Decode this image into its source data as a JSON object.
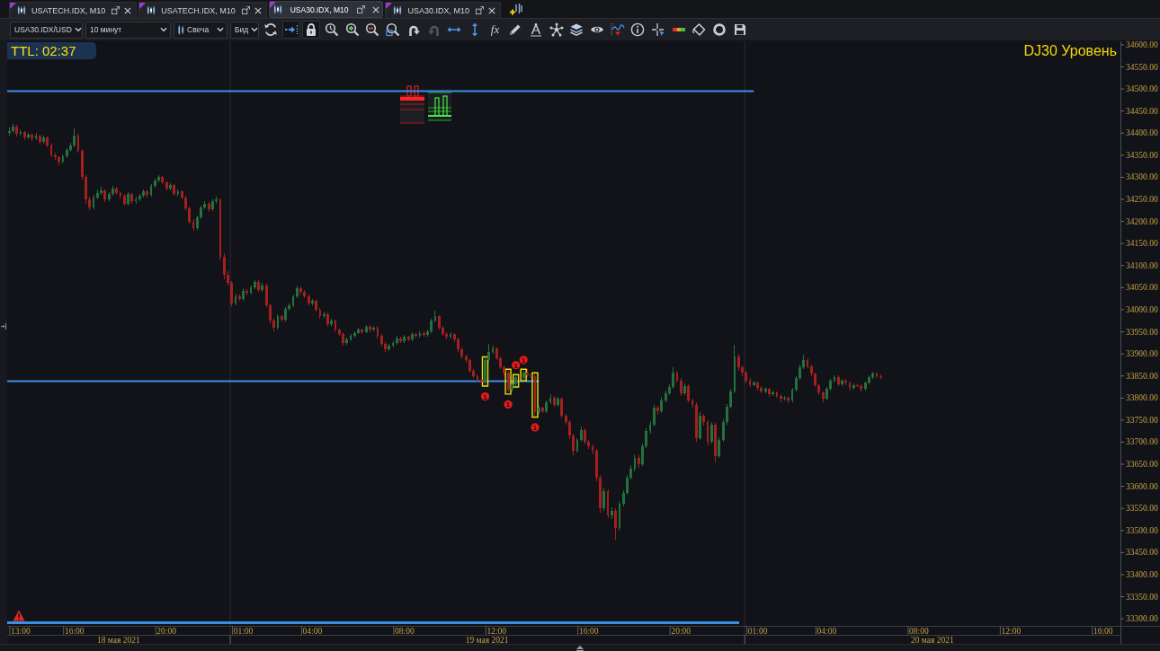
{
  "tabs": [
    {
      "label": "USATECH.IDX, M10",
      "selected": false
    },
    {
      "label": "USATECH.IDX, M10",
      "selected": false
    },
    {
      "label": "USA30.IDX, M10",
      "selected": true
    },
    {
      "label": "USA30.IDX, M10",
      "selected": false
    }
  ],
  "toolbar": {
    "symbol": "USA30.IDX/USD",
    "timeframe": "10 минут",
    "chart_type": "Свеча",
    "price_type": "Бид",
    "tools": [
      {
        "kind": "refresh",
        "on": false,
        "disabled": false
      },
      {
        "kind": "autoscroll",
        "on": true,
        "disabled": false
      },
      {
        "kind": "lock",
        "on": true,
        "disabled": false
      },
      {
        "kind": "zoom_reset",
        "on": false,
        "disabled": false
      },
      {
        "kind": "zoom_in",
        "on": false,
        "disabled": false
      },
      {
        "kind": "zoom_out",
        "on": false,
        "disabled": false
      },
      {
        "kind": "zoom_area",
        "on": false,
        "disabled": false
      },
      {
        "kind": "undo",
        "on": false,
        "disabled": false
      },
      {
        "kind": "redo",
        "on": false,
        "disabled": true
      },
      {
        "kind": "fit_horizontal",
        "on": false,
        "disabled": false
      },
      {
        "kind": "fit_vertical",
        "on": false,
        "disabled": false
      },
      {
        "kind": "indicator",
        "label": "fx",
        "on": false,
        "disabled": false
      },
      {
        "kind": "draw",
        "on": false,
        "disabled": false
      },
      {
        "kind": "text",
        "on": false,
        "disabled": false
      },
      {
        "kind": "objects",
        "on": false,
        "disabled": false
      },
      {
        "kind": "layers",
        "on": false,
        "disabled": false
      },
      {
        "kind": "visibility",
        "on": false,
        "disabled": false
      },
      {
        "kind": "overlay",
        "on": false,
        "disabled": false
      },
      {
        "kind": "info",
        "on": false,
        "disabled": false
      },
      {
        "kind": "crosshair",
        "on": false,
        "disabled": false
      },
      {
        "kind": "volume",
        "on": false,
        "disabled": false
      },
      {
        "kind": "fill",
        "on": false,
        "disabled": false
      },
      {
        "kind": "ring",
        "on": false,
        "disabled": false
      },
      {
        "kind": "save",
        "on": false,
        "disabled": false
      }
    ]
  },
  "chart": {
    "ttl": "TTL: 02:37",
    "level_label": "DJ30 Уровень",
    "date_labels": [
      "18 мая 2021",
      "19 мая 2021",
      "20 мая 2021"
    ],
    "chart_data": {
      "type": "candlestick",
      "ylim": [
        33284,
        34610
      ],
      "categories": [
        null,
        null,
        null,
        "13:00",
        null,
        null,
        null,
        null,
        null,
        null,
        null,
        null,
        null,
        null,
        null,
        null,
        null,
        "16:00",
        null,
        null,
        null,
        null,
        null,
        null,
        null,
        null,
        null,
        null,
        null,
        null,
        null,
        null,
        null,
        null,
        null,
        null,
        null,
        null,
        null,
        null,
        null,
        "20:00",
        null,
        null,
        null,
        null,
        null,
        null,
        null,
        null,
        null,
        null,
        null,
        null,
        null,
        null,
        null,
        null,
        null,
        null,
        null,
        "01:00",
        null,
        null,
        null,
        null,
        null,
        null,
        null,
        null,
        null,
        null,
        null,
        null,
        null,
        null,
        null,
        null,
        null,
        "04:00",
        null,
        null,
        null,
        null,
        null,
        null,
        null,
        null,
        null,
        null,
        null,
        null,
        null,
        null,
        null,
        null,
        null,
        null,
        null,
        null,
        null,
        null,
        null,
        "08:00",
        null,
        null,
        null,
        null,
        null,
        null,
        null,
        null,
        null,
        null,
        null,
        null,
        null,
        null,
        null,
        null,
        null,
        null,
        null,
        null,
        null,
        null,
        null,
        "12:00",
        null,
        null,
        null,
        null,
        null,
        null,
        null,
        null,
        null,
        null,
        null,
        null,
        null,
        null,
        null,
        null,
        null,
        null,
        null,
        null,
        null,
        null,
        null,
        "16:00",
        null,
        null,
        null,
        null,
        null,
        null,
        null,
        null,
        null,
        null,
        null,
        null,
        null,
        null,
        null,
        null,
        null,
        null,
        null,
        null,
        null,
        null,
        null,
        "20:00",
        null,
        null,
        null,
        null,
        null,
        null,
        null,
        null,
        null,
        null,
        null,
        null,
        null,
        null,
        null,
        null,
        null,
        null,
        null,
        "01:00",
        null,
        null,
        null,
        null,
        null,
        null,
        null,
        null,
        null,
        null,
        null,
        null,
        null,
        null,
        null,
        null,
        null,
        "04:00",
        null,
        null,
        null,
        null,
        null,
        null,
        null,
        null,
        null,
        null,
        null,
        null,
        null,
        null,
        null,
        null,
        null,
        null,
        null,
        null,
        null,
        null,
        null,
        "08:00",
        null,
        null,
        null,
        null,
        null,
        null,
        null,
        null,
        null,
        null,
        null,
        null,
        null,
        null,
        null,
        null,
        null,
        null,
        null,
        null,
        null,
        null,
        null,
        "12:00",
        null,
        null,
        null,
        null,
        null,
        null,
        null,
        null,
        null,
        null,
        null,
        null,
        null,
        null,
        null,
        null,
        null,
        null,
        null,
        null,
        null,
        null,
        null,
        "16:00",
        null,
        null,
        null,
        null
      ],
      "yticks": [
        {
          "value": 34600,
          "label": "34600.00"
        },
        {
          "value": 34550,
          "label": "34550.00"
        },
        {
          "value": 34500,
          "label": "34500.00"
        },
        {
          "value": 34450,
          "label": "34450.00"
        },
        {
          "value": 34400,
          "label": "34400.00"
        },
        {
          "value": 34350,
          "label": "34350.00"
        },
        {
          "value": 34300,
          "label": "34300.00"
        },
        {
          "value": 34250,
          "label": "34250.00"
        },
        {
          "value": 34200,
          "label": "34200.00"
        },
        {
          "value": 34150,
          "label": "34150.00"
        },
        {
          "value": 34100,
          "label": "34100.00"
        },
        {
          "value": 34050,
          "label": "34050.00"
        },
        {
          "value": 34000,
          "label": "34000.00"
        },
        {
          "value": 33950,
          "label": "33950.00"
        },
        {
          "value": 33900,
          "label": "33900.00"
        },
        {
          "value": 33850,
          "label": "33850.00"
        },
        {
          "value": 33800,
          "label": "33800.00"
        },
        {
          "value": 33750,
          "label": "33750.00"
        },
        {
          "value": 33700,
          "label": "33700.00"
        },
        {
          "value": 33650,
          "label": "33650.00"
        },
        {
          "value": 33600,
          "label": "33600.00"
        },
        {
          "value": 33550,
          "label": "33550.00"
        },
        {
          "value": 33500,
          "label": "33500.00"
        },
        {
          "value": 33450,
          "label": "33450.00"
        },
        {
          "value": 33400,
          "label": "33400.00"
        },
        {
          "value": 33350,
          "label": "33350.00"
        },
        {
          "value": 33300,
          "label": "33300.00"
        }
      ],
      "ref_lines": [
        {
          "axis": "y",
          "value": 34495,
          "color": "#3a8ee6"
        },
        {
          "axis": "y",
          "value": 33838,
          "color": "#3a8ee6"
        }
      ],
      "annotations": [
        "1",
        "1",
        "1",
        "1",
        "1"
      ],
      "ohlc": [
        [
          34400,
          34412,
          34395,
          34405
        ],
        [
          34405,
          34420,
          34401,
          34415
        ],
        [
          34415,
          34418,
          34392,
          34398
        ],
        [
          34398,
          34408,
          34394,
          34402
        ],
        [
          34402,
          34405,
          34385,
          34390
        ],
        [
          34390,
          34400,
          34386,
          34396
        ],
        [
          34396,
          34399,
          34382,
          34388
        ],
        [
          34388,
          34400,
          34384,
          34395
        ],
        [
          34395,
          34397,
          34375,
          34380
        ],
        [
          34380,
          34394,
          34377,
          34390
        ],
        [
          34390,
          34392,
          34368,
          34372
        ],
        [
          34372,
          34376,
          34345,
          34350
        ],
        [
          34350,
          34356,
          34340,
          34345
        ],
        [
          34345,
          34348,
          34328,
          34335
        ],
        [
          34335,
          34352,
          34331,
          34348
        ],
        [
          34348,
          34366,
          34344,
          34362
        ],
        [
          34362,
          34378,
          34358,
          34372
        ],
        [
          34372,
          34410,
          34368,
          34395
        ],
        [
          34395,
          34398,
          34355,
          34360
        ],
        [
          34360,
          34364,
          34295,
          34300
        ],
        [
          34300,
          34305,
          34240,
          34250
        ],
        [
          34250,
          34256,
          34225,
          34232
        ],
        [
          34232,
          34260,
          34228,
          34255
        ],
        [
          34255,
          34272,
          34250,
          34265
        ],
        [
          34265,
          34278,
          34260,
          34270
        ],
        [
          34270,
          34273,
          34244,
          34250
        ],
        [
          34250,
          34266,
          34246,
          34262
        ],
        [
          34262,
          34280,
          34258,
          34275
        ],
        [
          34275,
          34279,
          34260,
          34265
        ],
        [
          34265,
          34268,
          34252,
          34258
        ],
        [
          34258,
          34262,
          34235,
          34240
        ],
        [
          34240,
          34266,
          34236,
          34262
        ],
        [
          34262,
          34265,
          34240,
          34245
        ],
        [
          34245,
          34256,
          34240,
          34250
        ],
        [
          34250,
          34262,
          34246,
          34258
        ],
        [
          34258,
          34273,
          34254,
          34268
        ],
        [
          34268,
          34270,
          34255,
          34260
        ],
        [
          34260,
          34284,
          34256,
          34280
        ],
        [
          34280,
          34296,
          34276,
          34292
        ],
        [
          34292,
          34305,
          34288,
          34300
        ],
        [
          34300,
          34303,
          34284,
          34288
        ],
        [
          34288,
          34291,
          34270,
          34275
        ],
        [
          34275,
          34286,
          34271,
          34282
        ],
        [
          34282,
          34285,
          34258,
          34262
        ],
        [
          34262,
          34272,
          34257,
          34268
        ],
        [
          34268,
          34270,
          34250,
          34255
        ],
        [
          34255,
          34258,
          34225,
          34230
        ],
        [
          34230,
          34234,
          34195,
          34200
        ],
        [
          34200,
          34205,
          34178,
          34185
        ],
        [
          34185,
          34214,
          34180,
          34210
        ],
        [
          34210,
          34236,
          34205,
          34232
        ],
        [
          34232,
          34246,
          34228,
          34240
        ],
        [
          34240,
          34244,
          34222,
          34228
        ],
        [
          34228,
          34250,
          34224,
          34245
        ],
        [
          34245,
          34256,
          34240,
          34250
        ],
        [
          34250,
          34252,
          34112,
          34120
        ],
        [
          34120,
          34128,
          34070,
          34080
        ],
        [
          34080,
          34088,
          34055,
          34060
        ],
        [
          34060,
          34064,
          34008,
          34015
        ],
        [
          34015,
          34036,
          34010,
          34030
        ],
        [
          34030,
          34034,
          34020,
          34025
        ],
        [
          34025,
          34048,
          34021,
          34042
        ],
        [
          34042,
          34046,
          34032,
          34038
        ],
        [
          34038,
          34055,
          34034,
          34050
        ],
        [
          34050,
          34068,
          34046,
          34062
        ],
        [
          34062,
          34066,
          34040,
          34045
        ],
        [
          34045,
          34060,
          34041,
          34055
        ],
        [
          34055,
          34058,
          34005,
          34010
        ],
        [
          34010,
          34014,
          33970,
          33975
        ],
        [
          33975,
          33980,
          33952,
          33960
        ],
        [
          33960,
          33990,
          33956,
          33985
        ],
        [
          33985,
          33988,
          33972,
          33978
        ],
        [
          33978,
          34006,
          33974,
          34002
        ],
        [
          34002,
          34014,
          33998,
          34010
        ],
        [
          34010,
          34035,
          34006,
          34030
        ],
        [
          34030,
          34055,
          34026,
          34048
        ],
        [
          34048,
          34052,
          34035,
          34040
        ],
        [
          34040,
          34044,
          34026,
          34030
        ],
        [
          34030,
          34034,
          34010,
          34015
        ],
        [
          34015,
          34025,
          34011,
          34020
        ],
        [
          34020,
          34023,
          33996,
          34000
        ],
        [
          34000,
          34004,
          33980,
          33985
        ],
        [
          33985,
          33995,
          33981,
          33990
        ],
        [
          33990,
          33993,
          33962,
          33968
        ],
        [
          33968,
          33980,
          33964,
          33975
        ],
        [
          33975,
          33978,
          33950,
          33955
        ],
        [
          33955,
          33958,
          33940,
          33945
        ],
        [
          33945,
          33949,
          33918,
          33925
        ],
        [
          33925,
          33937,
          33921,
          33932
        ],
        [
          33932,
          33944,
          33928,
          33940
        ],
        [
          33940,
          33952,
          33936,
          33948
        ],
        [
          33948,
          33960,
          33944,
          33955
        ],
        [
          33955,
          33958,
          33945,
          33950
        ],
        [
          33950,
          33966,
          33946,
          33962
        ],
        [
          33962,
          33965,
          33950,
          33955
        ],
        [
          33955,
          33964,
          33951,
          33960
        ],
        [
          33960,
          33963,
          33935,
          33940
        ],
        [
          33940,
          33944,
          33917,
          33922
        ],
        [
          33922,
          33926,
          33904,
          33910
        ],
        [
          33910,
          33922,
          33906,
          33918
        ],
        [
          33918,
          33929,
          33914,
          33925
        ],
        [
          33925,
          33940,
          33921,
          33935
        ],
        [
          33935,
          33938,
          33924,
          33928
        ],
        [
          33928,
          33942,
          33924,
          33938
        ],
        [
          33938,
          33941,
          33928,
          33932
        ],
        [
          33932,
          33949,
          33928,
          33945
        ],
        [
          33945,
          33948,
          33936,
          33940
        ],
        [
          33940,
          33952,
          33936,
          33948
        ],
        [
          33948,
          33951,
          33938,
          33942
        ],
        [
          33942,
          33956,
          33938,
          33952
        ],
        [
          33952,
          33980,
          33948,
          33975
        ],
        [
          33975,
          33998,
          33971,
          33985
        ],
        [
          33985,
          33988,
          33955,
          33960
        ],
        [
          33960,
          33964,
          33940,
          33945
        ],
        [
          33945,
          33949,
          33932,
          33938
        ],
        [
          33938,
          33950,
          33934,
          33945
        ],
        [
          33945,
          33948,
          33926,
          33932
        ],
        [
          33932,
          33936,
          33905,
          33910
        ],
        [
          33910,
          33914,
          33890,
          33895
        ],
        [
          33895,
          33899,
          33880,
          33885
        ],
        [
          33885,
          33888,
          33857,
          33862
        ],
        [
          33862,
          33866,
          33845,
          33850
        ],
        [
          33850,
          33854,
          33836,
          33842
        ],
        [
          33842,
          33846,
          33832,
          33838
        ],
        [
          33838,
          33890,
          33830,
          33885
        ],
        [
          33885,
          33922,
          33880,
          33905
        ],
        [
          33905,
          33918,
          33900,
          33912
        ],
        [
          33912,
          33915,
          33885,
          33890
        ],
        [
          33890,
          33894,
          33865,
          33870
        ],
        [
          33870,
          33874,
          33852,
          33858
        ],
        [
          33858,
          33862,
          33812,
          33818
        ],
        [
          33818,
          33836,
          33814,
          33832
        ],
        [
          33832,
          33850,
          33828,
          33848
        ],
        [
          33848,
          33851,
          33840,
          33845
        ],
        [
          33845,
          33862,
          33842,
          33858
        ],
        [
          33858,
          33865,
          33848,
          33852
        ],
        [
          33852,
          33856,
          33846,
          33850
        ],
        [
          33850,
          33854,
          33760,
          33768
        ],
        [
          33768,
          33782,
          33764,
          33778
        ],
        [
          33778,
          33781,
          33765,
          33770
        ],
        [
          33770,
          33795,
          33766,
          33790
        ],
        [
          33790,
          33808,
          33786,
          33800
        ],
        [
          33800,
          33804,
          33780,
          33785
        ],
        [
          33785,
          33802,
          33781,
          33798
        ],
        [
          33798,
          33801,
          33755,
          33760
        ],
        [
          33760,
          33764,
          33740,
          33745
        ],
        [
          33745,
          33749,
          33708,
          33715
        ],
        [
          33715,
          33720,
          33670,
          33680
        ],
        [
          33680,
          33710,
          33676,
          33705
        ],
        [
          33705,
          33735,
          33700,
          33728
        ],
        [
          33728,
          33731,
          33694,
          33700
        ],
        [
          33700,
          33705,
          33684,
          33690
        ],
        [
          33690,
          33694,
          33672,
          33680
        ],
        [
          33680,
          33684,
          33612,
          33620
        ],
        [
          33620,
          33626,
          33540,
          33550
        ],
        [
          33550,
          33598,
          33545,
          33590
        ],
        [
          33590,
          33594,
          33528,
          33535
        ],
        [
          33535,
          33552,
          33525,
          33545
        ],
        [
          33545,
          33550,
          33480,
          33505
        ],
        [
          33505,
          33566,
          33500,
          33560
        ],
        [
          33560,
          33592,
          33555,
          33585
        ],
        [
          33585,
          33626,
          33580,
          33620
        ],
        [
          33620,
          33648,
          33615,
          33640
        ],
        [
          33640,
          33672,
          33634,
          33665
        ],
        [
          33665,
          33670,
          33642,
          33650
        ],
        [
          33650,
          33696,
          33646,
          33690
        ],
        [
          33690,
          33732,
          33686,
          33725
        ],
        [
          33725,
          33748,
          33720,
          33740
        ],
        [
          33740,
          33785,
          33736,
          33778
        ],
        [
          33778,
          33782,
          33762,
          33770
        ],
        [
          33770,
          33802,
          33766,
          33795
        ],
        [
          33795,
          33816,
          33790,
          33810
        ],
        [
          33810,
          33832,
          33806,
          33825
        ],
        [
          33825,
          33870,
          33820,
          33858
        ],
        [
          33858,
          33862,
          33835,
          33840
        ],
        [
          33840,
          33845,
          33804,
          33810
        ],
        [
          33810,
          33834,
          33806,
          33828
        ],
        [
          33828,
          33832,
          33790,
          33795
        ],
        [
          33795,
          33799,
          33778,
          33785
        ],
        [
          33785,
          33790,
          33700,
          33710
        ],
        [
          33710,
          33768,
          33705,
          33760
        ],
        [
          33760,
          33764,
          33738,
          33745
        ],
        [
          33745,
          33750,
          33692,
          33700
        ],
        [
          33700,
          33746,
          33696,
          33740
        ],
        [
          33740,
          33744,
          33655,
          33668
        ],
        [
          33668,
          33712,
          33664,
          33705
        ],
        [
          33705,
          33752,
          33700,
          33745
        ],
        [
          33745,
          33786,
          33740,
          33780
        ],
        [
          33780,
          33820,
          33776,
          33815
        ],
        [
          33815,
          33920,
          33810,
          33895
        ],
        [
          33895,
          33900,
          33862,
          33870
        ],
        [
          33870,
          33874,
          33850,
          33858
        ],
        [
          33858,
          33862,
          33834,
          33840
        ],
        [
          33840,
          33845,
          33824,
          33830
        ],
        [
          33830,
          33840,
          33826,
          33835
        ],
        [
          33835,
          33838,
          33816,
          33822
        ],
        [
          33822,
          33826,
          33810,
          33815
        ],
        [
          33815,
          33824,
          33811,
          33820
        ],
        [
          33820,
          33823,
          33802,
          33808
        ],
        [
          33808,
          33816,
          33804,
          33812
        ],
        [
          33812,
          33815,
          33800,
          33805
        ],
        [
          33805,
          33808,
          33790,
          33798
        ],
        [
          33798,
          33804,
          33794,
          33800
        ],
        [
          33800,
          33803,
          33788,
          33795
        ],
        [
          33795,
          33822,
          33791,
          33818
        ],
        [
          33818,
          33850,
          33814,
          33845
        ],
        [
          33845,
          33876,
          33841,
          33870
        ],
        [
          33870,
          33898,
          33866,
          33885
        ],
        [
          33885,
          33890,
          33868,
          33872
        ],
        [
          33872,
          33876,
          33850,
          33855
        ],
        [
          33855,
          33858,
          33825,
          33830
        ],
        [
          33830,
          33834,
          33806,
          33812
        ],
        [
          33812,
          33815,
          33790,
          33798
        ],
        [
          33798,
          33824,
          33794,
          33820
        ],
        [
          33820,
          33844,
          33816,
          33840
        ],
        [
          33840,
          33852,
          33836,
          33848
        ],
        [
          33848,
          33851,
          33828,
          33832
        ],
        [
          33832,
          33844,
          33828,
          33840
        ],
        [
          33840,
          33843,
          33830,
          33835
        ],
        [
          33835,
          33838,
          33816,
          33822
        ],
        [
          33822,
          33834,
          33818,
          33830
        ],
        [
          33830,
          33833,
          33824,
          33828
        ],
        [
          33828,
          33831,
          33815,
          33820
        ],
        [
          33820,
          33838,
          33816,
          33835
        ],
        [
          33835,
          33852,
          33831,
          33848
        ],
        [
          33848,
          33860,
          33844,
          33855
        ],
        [
          33855,
          33858,
          33846,
          33850
        ],
        [
          33850,
          33853,
          33844,
          33848
        ],
        null,
        null,
        null,
        null,
        null,
        null,
        null,
        null,
        null,
        null,
        null,
        null,
        null,
        null,
        null,
        null,
        null,
        null,
        null,
        null,
        null,
        null,
        null,
        null,
        null,
        null,
        null,
        null,
        null,
        null,
        null,
        null,
        null,
        null,
        null,
        null,
        null,
        null,
        null,
        null,
        null,
        null,
        null,
        null,
        null,
        null,
        null,
        null,
        null,
        null,
        null,
        null,
        null,
        null,
        null,
        null,
        null,
        null,
        null,
        null,
        null,
        null
      ]
    }
  }
}
